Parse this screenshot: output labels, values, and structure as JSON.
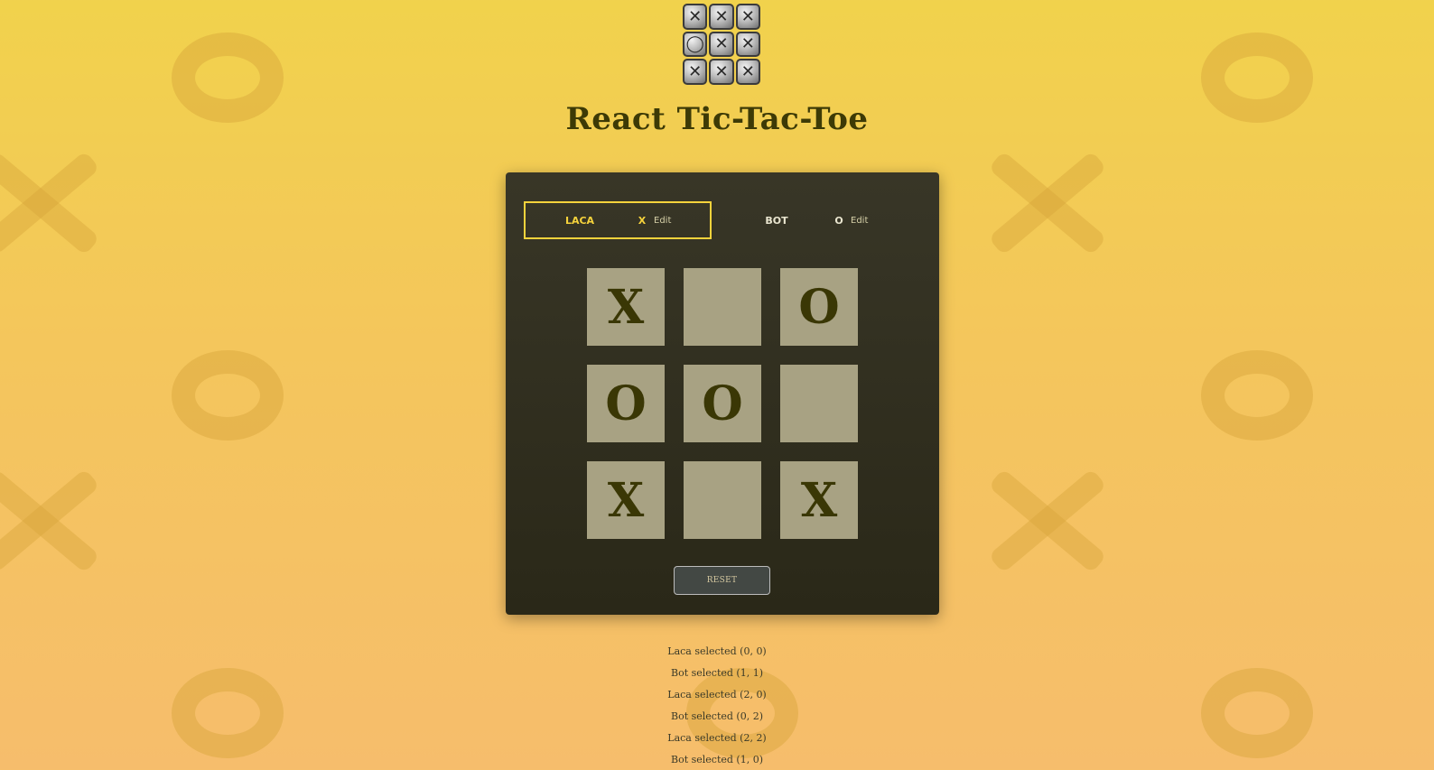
{
  "header": {
    "logo_cells": [
      "✕",
      "✕",
      "✕",
      "◯",
      "✕",
      "✕",
      "✕",
      "✕",
      "✕"
    ],
    "title": "React Tic-Tac-Toe"
  },
  "players": [
    {
      "name": "LACA",
      "symbol": "X",
      "edit_label": "Edit",
      "active": true
    },
    {
      "name": "BOT",
      "symbol": "O",
      "edit_label": "Edit",
      "active": false
    }
  ],
  "board": [
    [
      "X",
      "",
      "O"
    ],
    [
      "O",
      "O",
      ""
    ],
    [
      "X",
      "",
      "X"
    ]
  ],
  "reset_label": "RESET",
  "log": [
    "Laca selected (0, 0)",
    "Bot selected (1, 1)",
    "Laca selected (2, 0)",
    "Bot selected (0, 2)",
    "Laca selected (2, 2)",
    "Bot selected (1, 0)"
  ],
  "colors": {
    "accent": "#f6d33c",
    "cell_bg": "#a8a283",
    "mark": "#3a3705",
    "panel_bg": "#333121"
  }
}
